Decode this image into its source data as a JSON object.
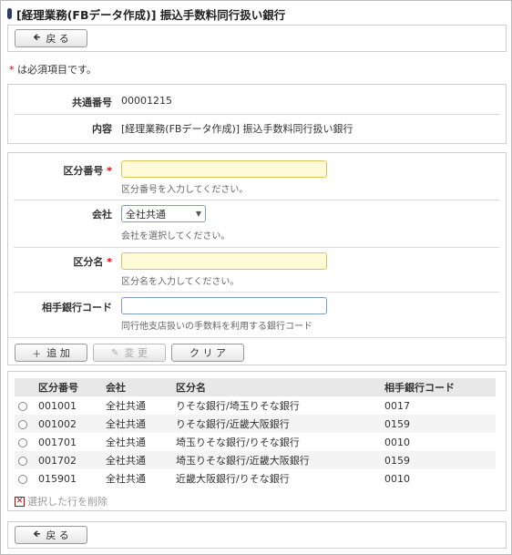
{
  "page": {
    "title": "[経理業務(FBデータ作成)] 振込手数料同行扱い銀行",
    "back_label": "戻 る",
    "required_note": "は必須項目です。",
    "required_star": "*"
  },
  "info": {
    "common_number_label": "共通番号",
    "common_number_value": "00001215",
    "content_label": "内容",
    "content_value": "[経理業務(FBデータ作成)] 振込手数料同行扱い銀行"
  },
  "form": {
    "category_number_label": "区分番号",
    "category_number_value": "",
    "category_number_hint": "区分番号を入力してください。",
    "company_label": "会社",
    "company_value": "全社共通",
    "company_hint": "会社を選択してください。",
    "category_name_label": "区分名",
    "category_name_value": "",
    "category_name_hint": "区分名を入力してください。",
    "partner_bank_label": "相手銀行コード",
    "partner_bank_value": "",
    "partner_bank_hint": "同行他支店扱いの手数料を利用する銀行コード"
  },
  "actions": {
    "add_label": "追 加",
    "change_label": "変 更",
    "clear_label": "ク リ ア"
  },
  "table": {
    "headers": [
      "区分番号",
      "会社",
      "区分名",
      "相手銀行コード"
    ],
    "rows": [
      {
        "num": "001001",
        "company": "全社共通",
        "name": "りそな銀行/埼玉りそな銀行",
        "code": "0017"
      },
      {
        "num": "001002",
        "company": "全社共通",
        "name": "りそな銀行/近畿大阪銀行",
        "code": "0159"
      },
      {
        "num": "001701",
        "company": "全社共通",
        "name": "埼玉りそな銀行/りそな銀行",
        "code": "0010"
      },
      {
        "num": "001702",
        "company": "全社共通",
        "name": "埼玉りそな銀行/近畿大阪銀行",
        "code": "0159"
      },
      {
        "num": "015901",
        "company": "全社共通",
        "name": "近畿大阪銀行/りそな銀行",
        "code": "0010"
      }
    ],
    "delete_label": "選択した行を削除"
  }
}
